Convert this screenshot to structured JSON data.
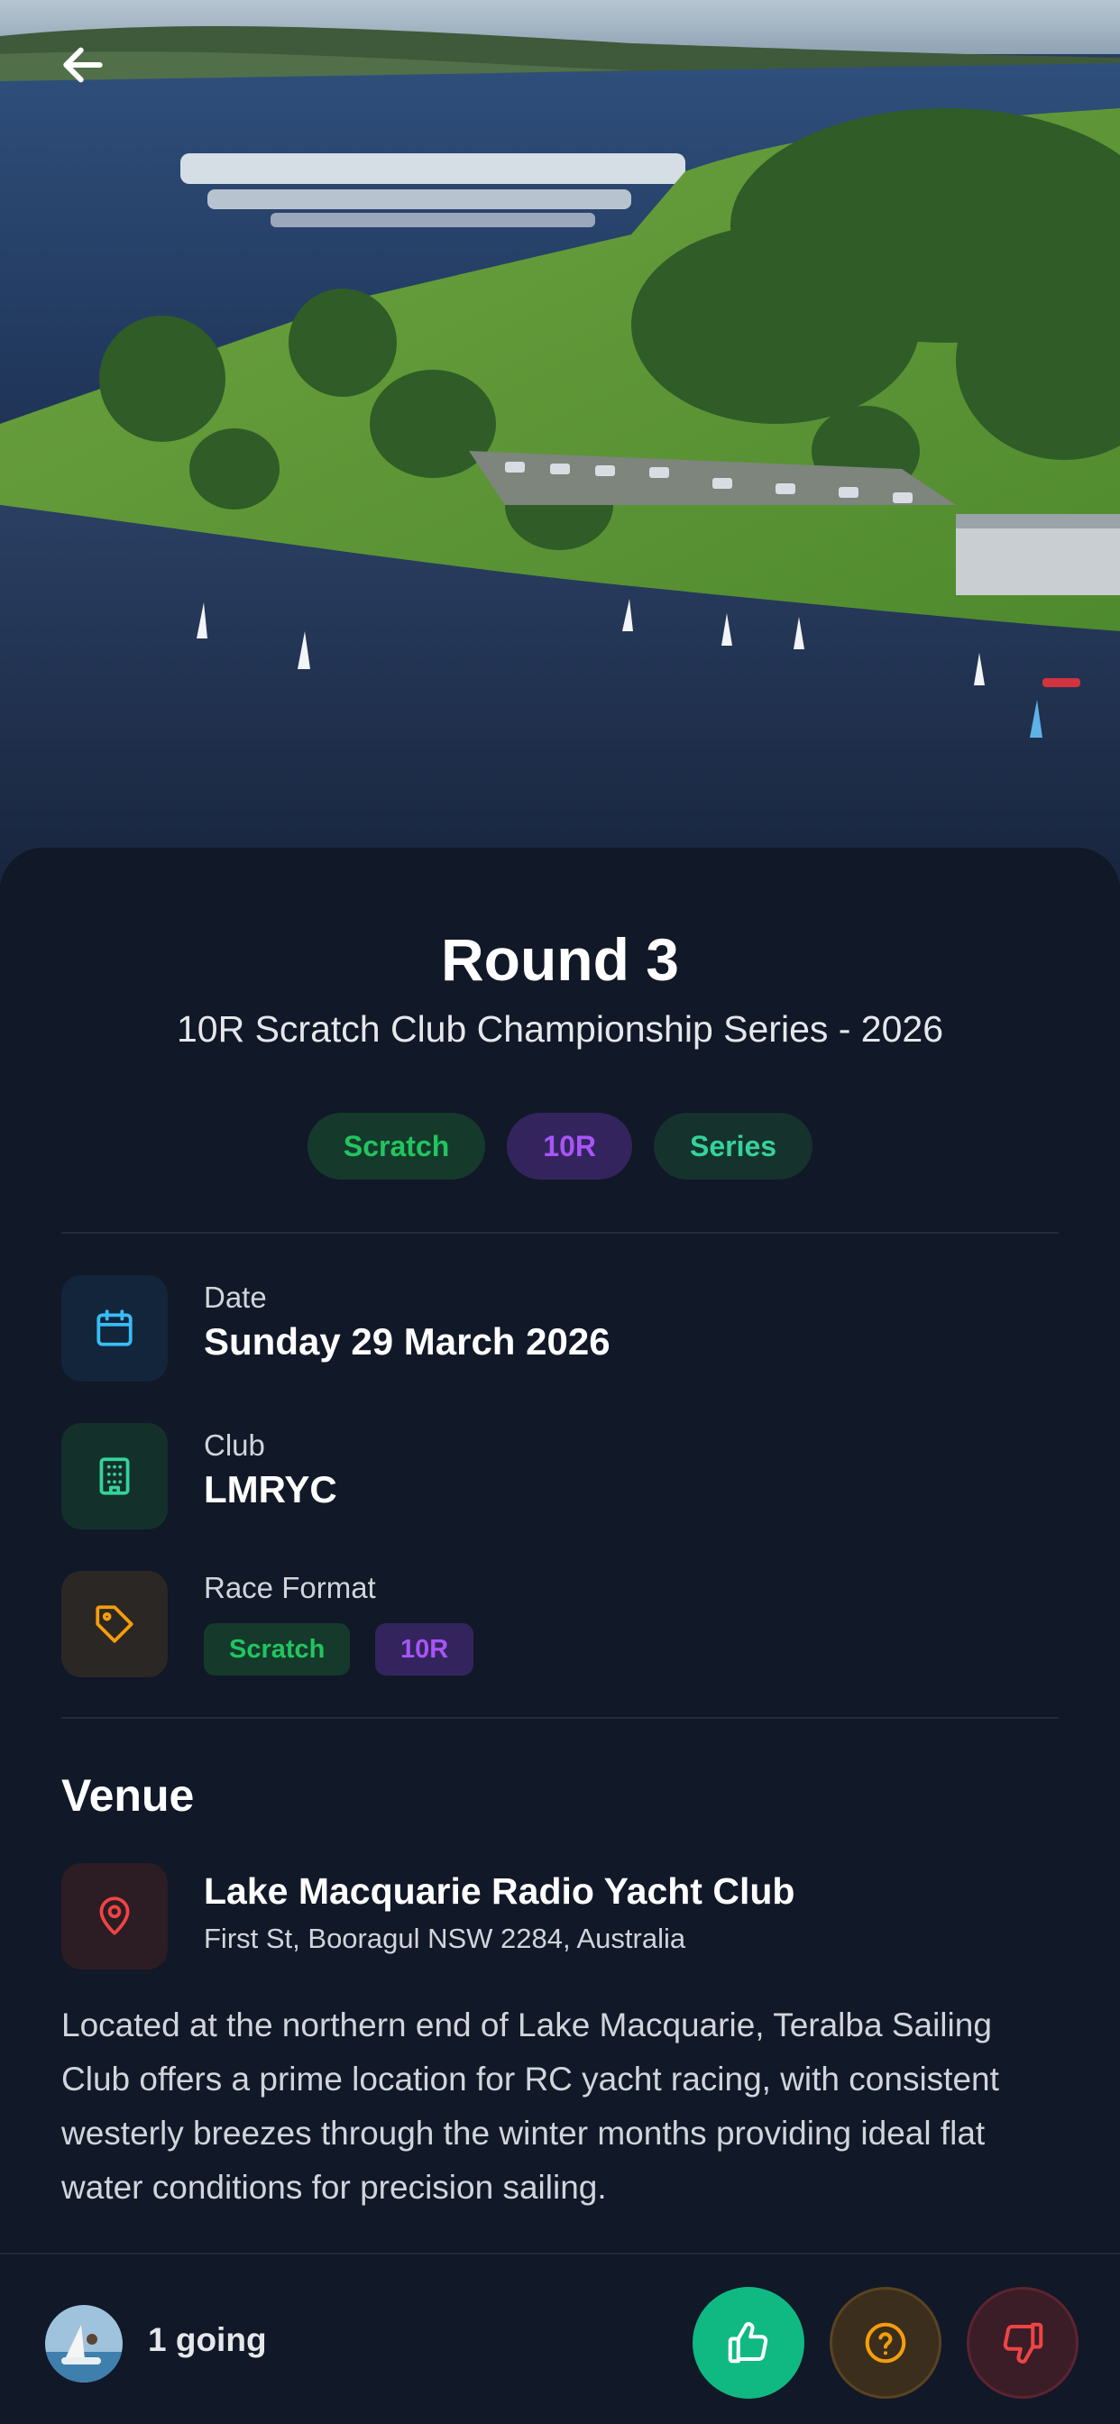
{
  "header": {
    "back_icon": "arrow-left-icon"
  },
  "event": {
    "title": "Round 3",
    "series": "10R Scratch Club Championship Series - 2026",
    "tags": [
      "Scratch",
      "10R",
      "Series"
    ]
  },
  "details": {
    "date": {
      "icon": "calendar-icon",
      "label": "Date",
      "value": "Sunday 29 March 2026"
    },
    "club": {
      "icon": "building-icon",
      "label": "Club",
      "value": "LMRYC"
    },
    "format": {
      "icon": "tag-icon",
      "label": "Race Format",
      "chips": [
        "Scratch",
        "10R"
      ]
    }
  },
  "venue": {
    "heading": "Venue",
    "icon": "map-pin-icon",
    "name": "Lake Macquarie Radio Yacht Club",
    "address": "First St, Booragul NSW 2284, Australia",
    "description": "Located at the northern end of Lake Macquarie, Teralba Sailing Club offers a prime location for RC yacht racing, with consistent westerly breezes through the winter months providing ideal flat water conditions for precision sailing."
  },
  "attendance": {
    "going_text": "1 going",
    "yes_icon": "thumbs-up-icon",
    "maybe_icon": "question-circle-icon",
    "no_icon": "thumbs-down-icon"
  },
  "colors": {
    "background": "#111827",
    "green": "#22c55e",
    "purple": "#a855f7",
    "teal": "#34d399",
    "accent_yes": "#10b981",
    "amber": "#f59e0b",
    "red": "#ef4444"
  }
}
